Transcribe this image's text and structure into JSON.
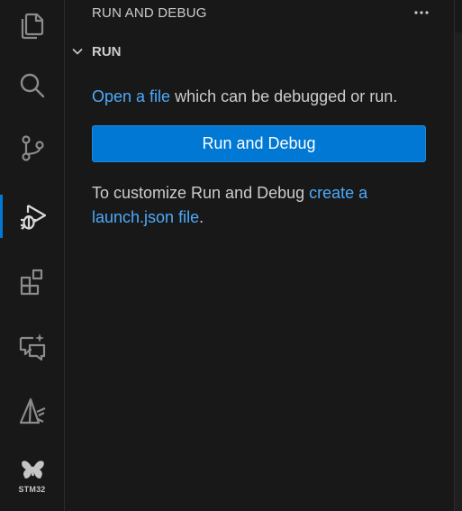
{
  "activity_bar": {
    "items": [
      {
        "name": "explorer",
        "icon": "files-icon"
      },
      {
        "name": "search",
        "icon": "search-icon"
      },
      {
        "name": "source-control",
        "icon": "source-control-icon"
      },
      {
        "name": "run-and-debug",
        "icon": "run-debug-icon",
        "active": true
      },
      {
        "name": "extensions",
        "icon": "extensions-icon"
      },
      {
        "name": "chat",
        "icon": "chat-sparkle-icon"
      },
      {
        "name": "testing",
        "icon": "flask-wrench-icon"
      },
      {
        "name": "stm32",
        "icon": "stm32-butterfly-icon"
      }
    ],
    "stm_label": "STM32"
  },
  "panel": {
    "title": "RUN AND DEBUG",
    "section_title": "RUN",
    "open_file_link": "Open a file",
    "open_file_rest": " which can be debugged or run.",
    "run_button": "Run and Debug",
    "customize_text": "To customize Run and Debug ",
    "customize_link": "create a launch.json file",
    "customize_end": "."
  },
  "colors": {
    "background": "#181818",
    "accent": "#0078d4",
    "link": "#4daafc",
    "text": "#cccccc"
  }
}
